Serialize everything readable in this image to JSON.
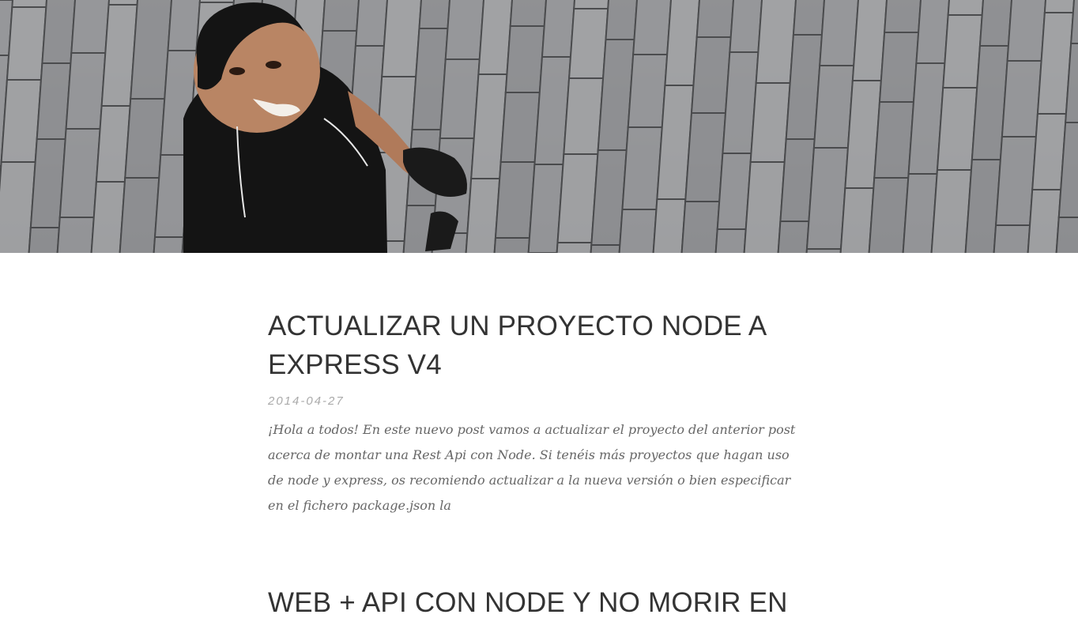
{
  "hero": {
    "image": "header-photo-smiling-man-on-paving-stones"
  },
  "posts": [
    {
      "title": "ACTUALIZAR UN PROYECTO NODE A EXPRESS V4",
      "date": "2014-04-27",
      "excerpt": "¡Hola a todos! En este nuevo post vamos a actualizar el proyecto del anterior post acerca de montar una Rest Api con Node. Si tenéis más proyectos que hagan uso de node y express, os recomiendo actualizar a la nueva versión o bien especificar en el fichero package.json la"
    },
    {
      "title": "WEB + API CON NODE Y NO MORIR EN"
    }
  ],
  "colors": {
    "title": "#333333",
    "date": "#aaaaaa",
    "excerpt": "#666666"
  }
}
